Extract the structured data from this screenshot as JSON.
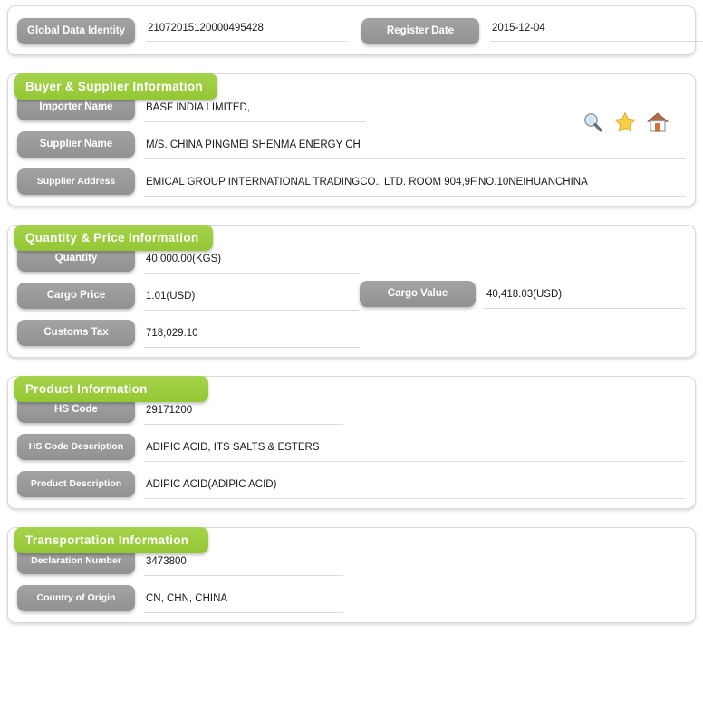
{
  "header": {
    "fields": [
      {
        "label": "Global Data Identity",
        "value": "21072015120000495428"
      },
      {
        "label": "Register Date",
        "value": "2015-12-04"
      }
    ]
  },
  "sections": [
    {
      "title": "Buyer & Supplier Information",
      "rows": [
        {
          "label": "Importer Name",
          "value": "BASF INDIA LIMITED,"
        },
        {
          "label": "Supplier Name",
          "value": "M/S. CHINA PINGMEI SHENMA ENERGY CH"
        },
        {
          "label": "Supplier Address",
          "value": "EMICAL GROUP INTERNATIONAL TRADINGCO., LTD. ROOM 904,9F,NO.10NEIHUANCHINA"
        }
      ]
    },
    {
      "title": "Quantity & Price Information",
      "rows": [
        {
          "label": "Quantity",
          "value": "40,000.00(KGS)"
        },
        {
          "label": "Cargo Price",
          "value": "1.01(USD)"
        },
        {
          "label": "Customs Tax",
          "value": "718,029.10"
        }
      ],
      "side_row": {
        "label": "Cargo Value",
        "value": "40,418.03(USD)"
      }
    },
    {
      "title": "Product Information",
      "rows": [
        {
          "label": "HS Code",
          "value": "29171200"
        },
        {
          "label": "HS Code Description",
          "value": "ADIPIC ACID, ITS SALTS & ESTERS"
        },
        {
          "label": "Product Description",
          "value": "ADIPIC ACID(ADIPIC ACID)"
        }
      ]
    },
    {
      "title": "Transportation Information",
      "rows": [
        {
          "label": "Declaration Number",
          "value": "3473800"
        },
        {
          "label": "Country of Origin",
          "value": "CN, CHN, CHINA"
        }
      ]
    }
  ],
  "action_icons": [
    {
      "name": "search-icon",
      "title": "Search"
    },
    {
      "name": "star-icon",
      "title": "Favorite"
    },
    {
      "name": "home-icon",
      "title": "Home"
    }
  ],
  "colors": {
    "section_green": "#9acd3c",
    "label_gray": "#9a9a9a",
    "card_border": "#d9d9d9",
    "underline": "#dcdcdc",
    "star_yellow": "#f5c33b",
    "home_roof": "#a35b3a"
  }
}
